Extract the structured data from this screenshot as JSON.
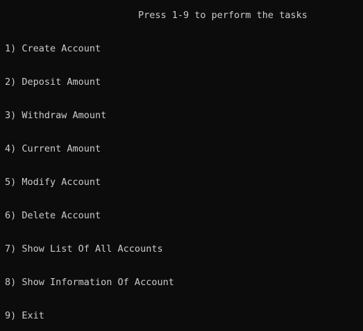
{
  "console": {
    "header": "Press 1-9 to perform the tasks",
    "items": [
      "1) Create Account",
      "2) Deposit Amount",
      "3) Withdraw Amount",
      "4) Current Amount",
      "5) Modify Account",
      "6) Delete Account",
      "7) Show List Of All Accounts",
      "8) Show Information Of Account",
      "9) Exit"
    ]
  },
  "colors": {
    "background": "#0c0c0c",
    "text": "#cccccc"
  }
}
